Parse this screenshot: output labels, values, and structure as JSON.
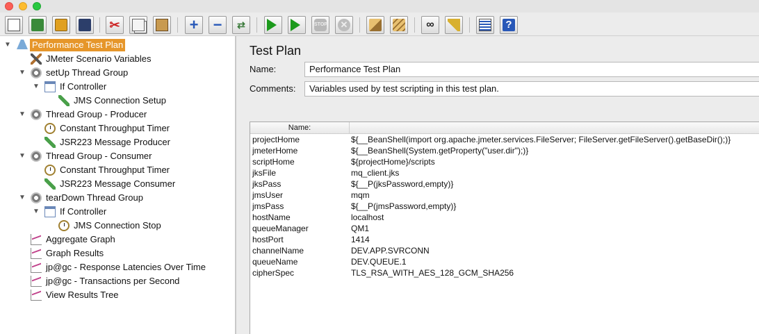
{
  "toolbar": {
    "buttons": [
      {
        "name": "new-button",
        "icon": "new-doc-icon",
        "tooltip": ""
      },
      {
        "name": "templates-button",
        "icon": "templates-icon"
      },
      {
        "name": "open-button",
        "icon": "open-folder-icon"
      },
      {
        "name": "save-button",
        "icon": "save-icon"
      },
      {
        "name": "cut-button",
        "icon": "scissors-icon",
        "glyph": "✂"
      },
      {
        "name": "copy-button",
        "icon": "copy-icon"
      },
      {
        "name": "paste-button",
        "icon": "paste-icon"
      },
      {
        "name": "expand-button",
        "icon": "plus-icon",
        "glyph": "+"
      },
      {
        "name": "collapse-button",
        "icon": "minus-icon",
        "glyph": "−"
      },
      {
        "name": "toggle-button",
        "icon": "toggle-icon",
        "glyph": "⇄"
      },
      {
        "name": "start-button",
        "icon": "play-icon"
      },
      {
        "name": "start-no-pauses-button",
        "icon": "play-no-pause-icon"
      },
      {
        "name": "stop-button",
        "icon": "stop-icon",
        "glyph": "STOP"
      },
      {
        "name": "shutdown-button",
        "icon": "shutdown-icon",
        "glyph": "✕"
      },
      {
        "name": "clear-button",
        "icon": "clear-icon"
      },
      {
        "name": "clear-all-button",
        "icon": "clear-all-icon"
      },
      {
        "name": "search-button",
        "icon": "binoculars-icon",
        "glyph": "∞"
      },
      {
        "name": "reset-search-button",
        "icon": "broom-icon"
      },
      {
        "name": "function-helper-button",
        "icon": "list-icon"
      },
      {
        "name": "help-button",
        "icon": "help-icon",
        "glyph": "?"
      }
    ]
  },
  "tree": {
    "items": [
      {
        "label": "Performance Test Plan",
        "icon": "test-plan-flask-icon",
        "expanded": true,
        "selected": true
      },
      {
        "label": "JMeter Scenario Variables",
        "icon": "config-tools-icon"
      },
      {
        "label": "setUp Thread Group",
        "icon": "thread-group-gear-icon",
        "expanded": true
      },
      {
        "label": "If Controller",
        "icon": "if-controller-icon",
        "expanded": true
      },
      {
        "label": "JMS Connection Setup",
        "icon": "sampler-pen-icon"
      },
      {
        "label": "Thread Group - Producer",
        "icon": "thread-group-gear-icon",
        "expanded": true
      },
      {
        "label": "Constant Throughput Timer",
        "icon": "timer-icon"
      },
      {
        "label": "JSR223 Message Producer",
        "icon": "sampler-pen-icon"
      },
      {
        "label": "Thread Group - Consumer",
        "icon": "thread-group-gear-icon",
        "expanded": true
      },
      {
        "label": "Constant Throughput Timer",
        "icon": "timer-icon"
      },
      {
        "label": "JSR223 Message Consumer",
        "icon": "sampler-pen-icon"
      },
      {
        "label": "tearDown Thread Group",
        "icon": "thread-group-gear-icon",
        "expanded": true
      },
      {
        "label": "If Controller",
        "icon": "if-controller-icon",
        "expanded": true
      },
      {
        "label": "JMS Connection Stop",
        "icon": "timer-icon"
      },
      {
        "label": "Aggregate Graph",
        "icon": "listener-graph-icon"
      },
      {
        "label": "Graph Results",
        "icon": "listener-graph-icon"
      },
      {
        "label": "jp@gc - Response Latencies Over Time",
        "icon": "listener-graph-icon"
      },
      {
        "label": "jp@gc - Transactions per Second",
        "icon": "listener-graph-icon"
      },
      {
        "label": "View Results Tree",
        "icon": "listener-graph-icon"
      }
    ]
  },
  "main": {
    "title": "Test Plan",
    "name_label": "Name:",
    "name_value": "Performance Test Plan",
    "comments_label": "Comments:",
    "comments_value": "Variables used by test scripting in this test plan.",
    "table": {
      "col_name": "Name:",
      "col_value": "",
      "rows": [
        {
          "name": "projectHome",
          "value": "${__BeanShell(import org.apache.jmeter.services.FileServer; FileServer.getFileServer().getBaseDir();)}"
        },
        {
          "name": "jmeterHome",
          "value": "${__BeanShell(System.getProperty(\"user.dir\");)}"
        },
        {
          "name": "scriptHome",
          "value": "${projectHome}/scripts"
        },
        {
          "name": "jksFile",
          "value": "mq_client.jks"
        },
        {
          "name": "jksPass",
          "value": "${__P(jksPassword,empty)}"
        },
        {
          "name": "jmsUser",
          "value": "mqm"
        },
        {
          "name": "jmsPass",
          "value": "${__P(jmsPassword,empty)}"
        },
        {
          "name": "hostName",
          "value": "localhost"
        },
        {
          "name": "queueManager",
          "value": "QM1"
        },
        {
          "name": "hostPort",
          "value": "1414"
        },
        {
          "name": "channelName",
          "value": "DEV.APP.SVRCONN"
        },
        {
          "name": "queueName",
          "value": "DEV.QUEUE.1"
        },
        {
          "name": "cipherSpec",
          "value": "TLS_RSA_WITH_AES_128_GCM_SHA256"
        }
      ]
    }
  },
  "colors": {
    "selection": "#e6962a",
    "tree_bg": "#ffffff",
    "panel_bg": "#ececec"
  }
}
